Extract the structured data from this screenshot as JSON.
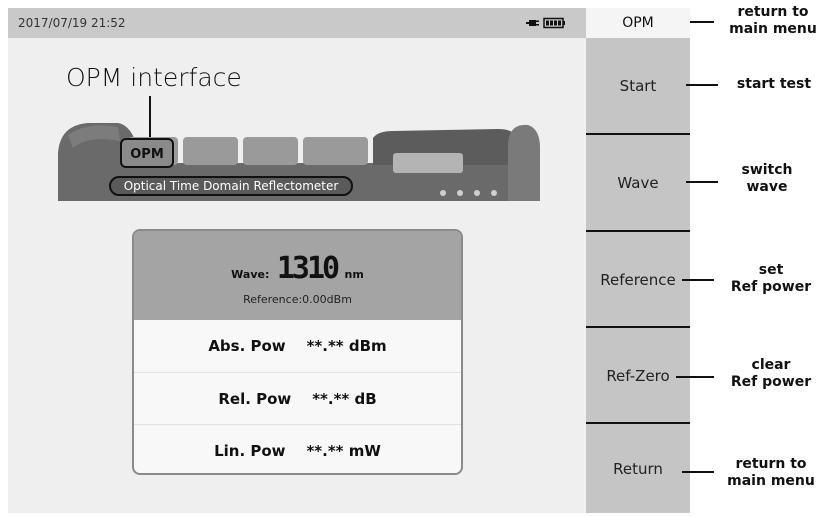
{
  "status_bar": {
    "datetime": "2017/07/19 21:52",
    "icons": [
      "plug-icon",
      "battery-icon"
    ]
  },
  "interface_label": "OPM interface",
  "device": {
    "opm_tag": "OPM",
    "caption": "Optical Time Domain Reflectometer"
  },
  "panel": {
    "wave_label": "Wave:",
    "wave_value": "1310",
    "wave_unit": "nm",
    "reference_text": "Reference:0.00dBm",
    "rows": [
      {
        "label": "Abs. Pow",
        "value": "**.** dBm"
      },
      {
        "label": "Rel. Pow",
        "value": "**.** dB"
      },
      {
        "label": "Lin. Pow",
        "value": "**.** mW"
      }
    ]
  },
  "sidebar": {
    "title": "OPM",
    "buttons": [
      {
        "label": "Start"
      },
      {
        "label": "Wave"
      },
      {
        "label": "Reference"
      },
      {
        "label": "Ref-Zero"
      },
      {
        "label": "Return"
      }
    ]
  },
  "callouts": {
    "title": {
      "line1": "return to",
      "line2": "main menu"
    },
    "start": {
      "line1": "start test",
      "line2": ""
    },
    "wave": {
      "line1": "switch",
      "line2": "wave"
    },
    "reference": {
      "line1": "set",
      "line2": "Ref power"
    },
    "refzero": {
      "line1": "clear",
      "line2": "Ref power"
    },
    "return": {
      "line1": "return to",
      "line2": "main menu"
    }
  },
  "colors": {
    "screen_bg": "#efefef",
    "panel_header": "#a4a4a4",
    "sidebar_button": "#c5c5c5",
    "sidebar_title_bg": "#f5f5f5"
  }
}
